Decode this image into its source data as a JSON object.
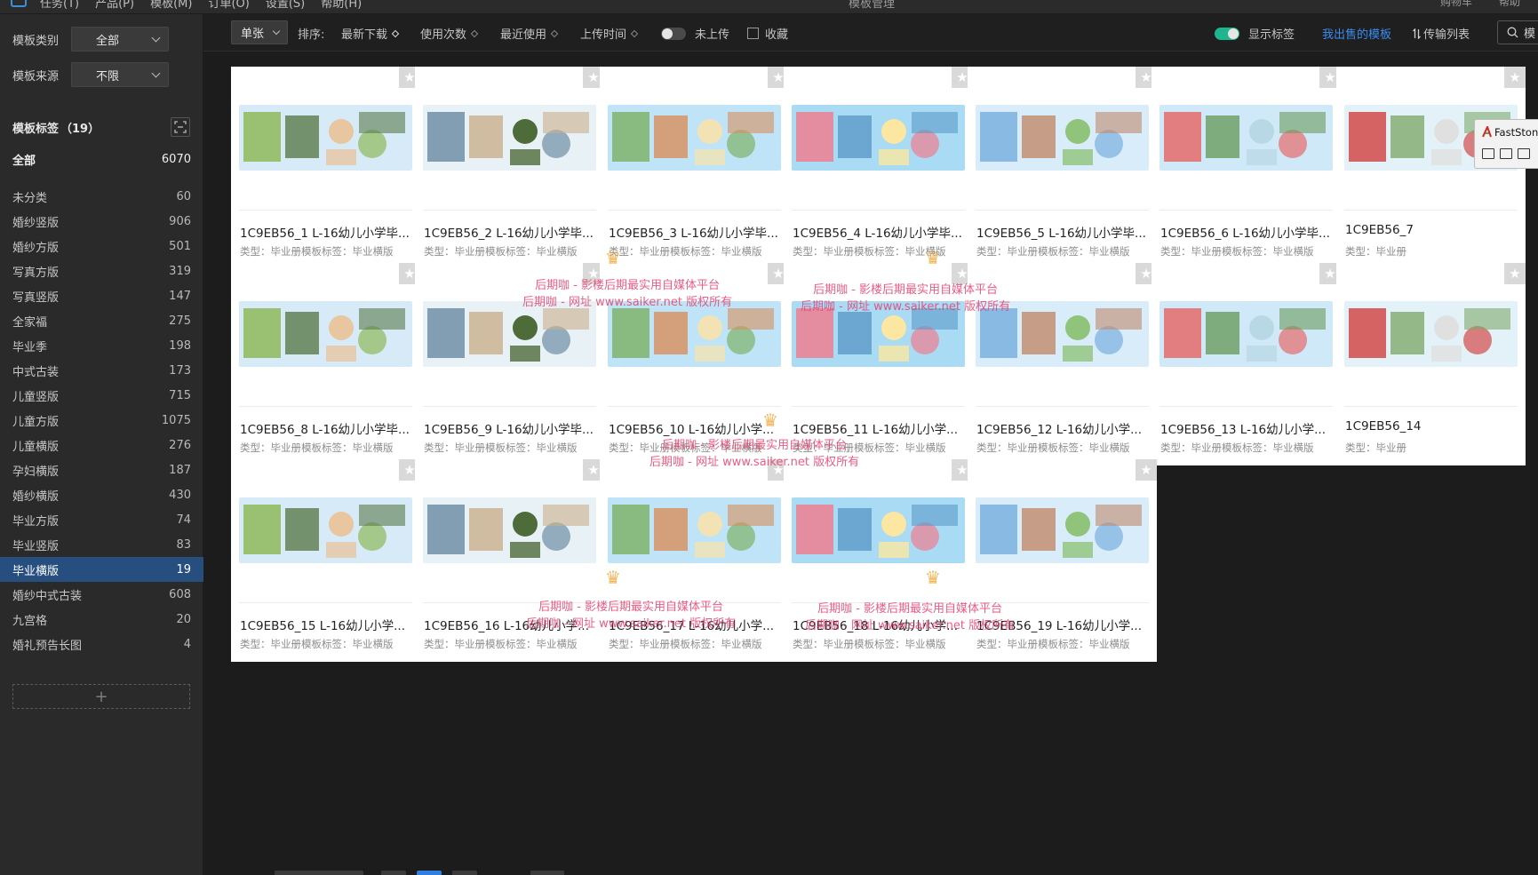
{
  "menubar": {
    "items": [
      "任务(T)",
      "产品(P)",
      "模板(M)",
      "订单(O)",
      "设置(S)",
      "帮助(H)"
    ],
    "window_title": "模板管理",
    "right_items": [
      "购物车",
      "帮助"
    ]
  },
  "sidebar": {
    "category_label": "模板类别",
    "category_value": "全部",
    "source_label": "模板来源",
    "source_value": "不限",
    "tags_title": "模板标签",
    "tags_count": "（19）",
    "all": {
      "label": "全部",
      "count": "6070"
    },
    "tags": [
      {
        "label": "未分类",
        "count": "60"
      },
      {
        "label": "婚纱竖版",
        "count": "906"
      },
      {
        "label": "婚纱方版",
        "count": "501"
      },
      {
        "label": "写真方版",
        "count": "319"
      },
      {
        "label": "写真竖版",
        "count": "147"
      },
      {
        "label": "全家福",
        "count": "275"
      },
      {
        "label": "毕业季",
        "count": "198"
      },
      {
        "label": "中式古装",
        "count": "173"
      },
      {
        "label": "儿童竖版",
        "count": "715"
      },
      {
        "label": "儿童方版",
        "count": "1075"
      },
      {
        "label": "儿童横版",
        "count": "276"
      },
      {
        "label": "孕妇横版",
        "count": "187"
      },
      {
        "label": "婚纱横版",
        "count": "430"
      },
      {
        "label": "毕业方版",
        "count": "74"
      },
      {
        "label": "毕业竖版",
        "count": "83"
      },
      {
        "label": "毕业横版",
        "count": "19",
        "active": true
      },
      {
        "label": "婚纱中式古装",
        "count": "608"
      },
      {
        "label": "九宫格",
        "count": "20"
      },
      {
        "label": "婚礼预告长图",
        "count": "4"
      }
    ],
    "add_tag_symbol": "+"
  },
  "toolbar": {
    "page_mode": "单张",
    "sort_label": "排序:",
    "sort_options": [
      "最新下载",
      "使用次数",
      "最近使用",
      "上传时间"
    ],
    "not_uploaded": "未上传",
    "favorite": "收藏",
    "show_tags": "显示标签",
    "my_sold": "我出售的模板",
    "transfer_list": "传输列表",
    "search_text": "模"
  },
  "colors": {
    "accent_blue": "#3b8cf0",
    "toggle_on": "#1fb58f",
    "active_tag_bg": "#264e7e",
    "watermark": "#e6416f"
  },
  "cards": [
    {
      "name": "1C9EB56_1  L-16幼儿小学毕...",
      "meta": "类型：毕业册模板标签：毕业横版"
    },
    {
      "name": "1C9EB56_2  L-16幼儿小学毕...",
      "meta": "类型：毕业册模板标签：毕业横版"
    },
    {
      "name": "1C9EB56_3  L-16幼儿小学毕...",
      "meta": "类型：毕业册模板标签：毕业横版"
    },
    {
      "name": "1C9EB56_4  L-16幼儿小学毕...",
      "meta": "类型：毕业册模板标签：毕业横版"
    },
    {
      "name": "1C9EB56_5  L-16幼儿小学毕...",
      "meta": "类型：毕业册模板标签：毕业横版"
    },
    {
      "name": "1C9EB56_6  L-16幼儿小学毕...",
      "meta": "类型：毕业册模板标签：毕业横版"
    },
    {
      "name": "1C9EB56_7",
      "meta": "类型：毕业册"
    },
    {
      "name": "1C9EB56_8  L-16幼儿小学毕...",
      "meta": "类型：毕业册模板标签：毕业横版"
    },
    {
      "name": "1C9EB56_9  L-16幼儿小学毕...",
      "meta": "类型：毕业册模板标签：毕业横版"
    },
    {
      "name": "1C9EB56_10  L-16幼儿小学...",
      "meta": "类型：毕业册模板标签：毕业横版"
    },
    {
      "name": "1C9EB56_11  L-16幼儿小学...",
      "meta": "类型：毕业册模板标签：毕业横版"
    },
    {
      "name": "1C9EB56_12  L-16幼儿小学...",
      "meta": "类型：毕业册模板标签：毕业横版"
    },
    {
      "name": "1C9EB56_13  L-16幼儿小学...",
      "meta": "类型：毕业册模板标签：毕业横版"
    },
    {
      "name": "1C9EB56_14",
      "meta": "类型：毕业册"
    },
    {
      "name": "1C9EB56_15  L-16幼儿小学...",
      "meta": "类型：毕业册模板标签：毕业横版"
    },
    {
      "name": "1C9EB56_16  L-16幼儿小学...",
      "meta": "类型：毕业册模板标签：毕业横版"
    },
    {
      "name": "1C9EB56_17  L-16幼儿小学...",
      "meta": "类型：毕业册模板标签：毕业横版"
    },
    {
      "name": "1C9EB56_18  L-16幼儿小学...",
      "meta": "类型：毕业册模板标签：毕业横版"
    },
    {
      "name": "1C9EB56_19  L-16幼儿小学...",
      "meta": "类型：毕业册模板标签：毕业横版"
    }
  ],
  "watermark": {
    "line1": "后期咖 - 影楼后期最实用自媒体平台",
    "line2": "后期咖 - 网址 www.saiker.net 版权所有"
  },
  "popup": {
    "title": "FastStone"
  }
}
